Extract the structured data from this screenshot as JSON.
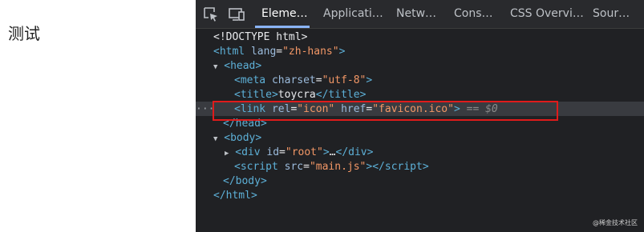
{
  "page": {
    "text": "测试"
  },
  "devtools": {
    "tabs": [
      {
        "label": "Eleme…",
        "active": true
      },
      {
        "label": "Applicati…"
      },
      {
        "label": "Netw…"
      },
      {
        "label": "Cons…"
      },
      {
        "label": "CSS Overvi…"
      },
      {
        "label": "Sour…"
      }
    ],
    "icons": {
      "inspect": "inspect-element-icon",
      "device": "device-toolbar-icon"
    },
    "dom": {
      "doctype": "<!DOCTYPE html>",
      "html_open": "html",
      "lang_attr": "lang",
      "lang_val": "\"zh-hans\"",
      "head": "head",
      "meta": "meta",
      "charset_attr": "charset",
      "charset_val": "\"utf-8\"",
      "title_tag": "title",
      "title_text": "toycra",
      "link": "link",
      "rel_attr": "rel",
      "rel_val": "\"icon\"",
      "href_attr": "href",
      "href_val": "\"favicon.ico\"",
      "selected_marker": "== $0",
      "head_close": "/head",
      "body": "body",
      "div": "div",
      "id_attr": "id",
      "id_val": "\"root\"",
      "div_ellipsis": "…",
      "div_close": "/div",
      "script": "script",
      "src_attr": "src",
      "src_val": "\"main.js\"",
      "script_close": "/script",
      "body_close": "/body",
      "html_close": "/html",
      "gutter_dots": "···"
    },
    "colors": {
      "highlight": "#e01b1b",
      "tag": "#5db0d7",
      "attr": "#9bbbdc",
      "value": "#f29766"
    }
  },
  "watermark": "@稀金技术社区"
}
